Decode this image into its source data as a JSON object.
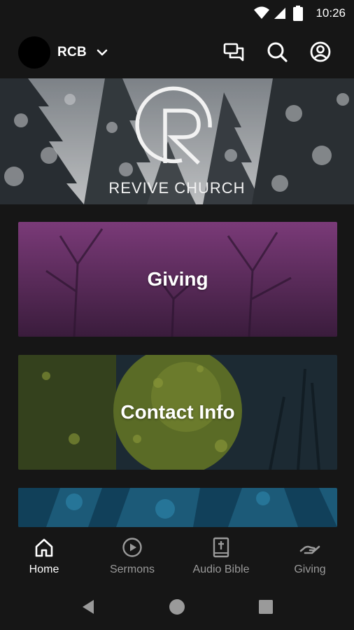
{
  "status_bar": {
    "time": "10:26"
  },
  "header": {
    "org_name": "RCB"
  },
  "banner": {
    "brand_text": "REVIVE CHURCH"
  },
  "cards": [
    {
      "label": "Giving"
    },
    {
      "label": "Contact Info"
    },
    {
      "label": ""
    }
  ],
  "bottom_nav": {
    "items": [
      {
        "label": "Home",
        "icon": "home-icon",
        "active": true
      },
      {
        "label": "Sermons",
        "icon": "play-circle-icon",
        "active": false
      },
      {
        "label": "Audio Bible",
        "icon": "bible-icon",
        "active": false
      },
      {
        "label": "Giving",
        "icon": "giving-hand-icon",
        "active": false
      }
    ]
  },
  "colors": {
    "background": "#161616",
    "giving_card": "#5a2a58",
    "contact_card": "#3c4a1e",
    "third_card": "#1c5a78",
    "inactive_label": "#9a9a9a"
  }
}
